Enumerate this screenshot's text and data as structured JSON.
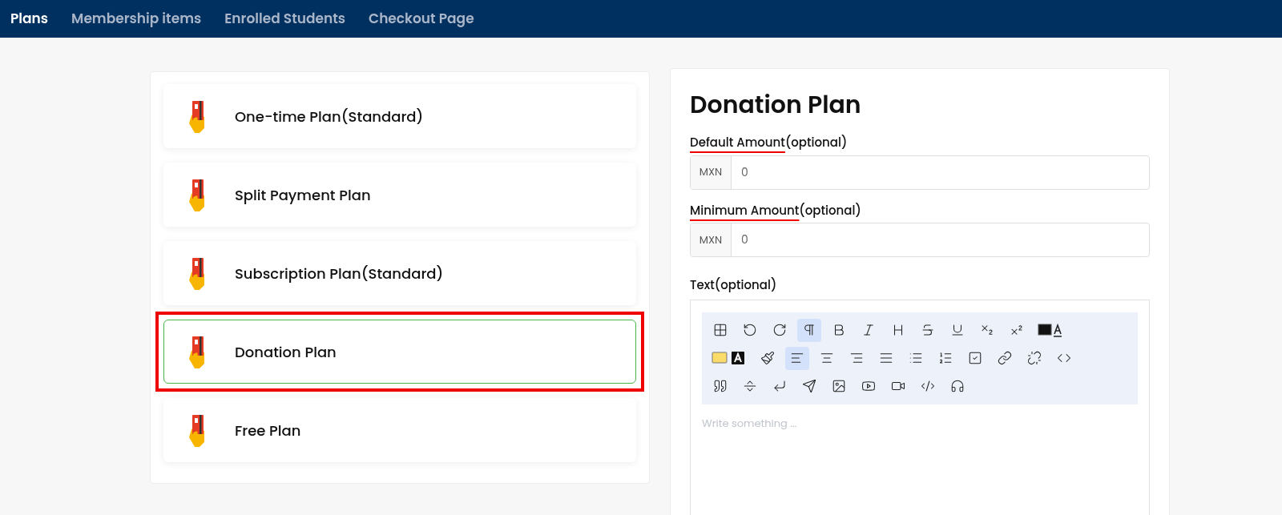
{
  "nav": {
    "tabs": [
      {
        "label": "Plans",
        "selected": true
      },
      {
        "label": "Membership items",
        "selected": false
      },
      {
        "label": "Enrolled Students",
        "selected": false
      },
      {
        "label": "Checkout Page",
        "selected": false
      }
    ]
  },
  "plans": [
    {
      "name": "One-time Plan(Standard)",
      "selected": false,
      "highlighted": false
    },
    {
      "name": "Split Payment Plan",
      "selected": false,
      "highlighted": false
    },
    {
      "name": "Subscription Plan(Standard)",
      "selected": false,
      "highlighted": false
    },
    {
      "name": "Donation Plan",
      "selected": true,
      "highlighted": true
    },
    {
      "name": "Free Plan",
      "selected": false,
      "highlighted": false
    }
  ],
  "form": {
    "title": "Donation Plan",
    "fields": [
      {
        "label": "Default Amount",
        "suffix": "(optional)",
        "underlined": true,
        "currency": "MXN",
        "value": "0"
      },
      {
        "label": "Minimum Amount",
        "suffix": "(optional)",
        "underlined": true,
        "currency": "MXN",
        "value": "0"
      }
    ],
    "editor": {
      "label": "Text(optional)",
      "placeholder": "Write something ...",
      "toolbar": [
        [
          {
            "kind": "table",
            "active": false
          },
          {
            "kind": "undo",
            "active": false
          },
          {
            "kind": "redo",
            "active": false
          },
          {
            "kind": "paragraph",
            "active": true
          },
          {
            "kind": "bold",
            "active": false
          },
          {
            "kind": "italic",
            "active": false
          },
          {
            "kind": "heading",
            "active": false
          },
          {
            "kind": "strike",
            "active": false
          },
          {
            "kind": "underline",
            "active": false
          },
          {
            "kind": "subscript",
            "active": false
          },
          {
            "kind": "superscript",
            "active": false
          },
          {
            "kind": "forecolor",
            "active": false
          }
        ],
        [
          {
            "kind": "highlight",
            "active": false
          },
          {
            "kind": "clear",
            "active": false
          },
          {
            "kind": "align-left",
            "active": true
          },
          {
            "kind": "align-center",
            "active": false
          },
          {
            "kind": "align-right",
            "active": false
          },
          {
            "kind": "align-justify",
            "active": false
          },
          {
            "kind": "bullet-list",
            "active": false
          },
          {
            "kind": "ordered-list",
            "active": false
          },
          {
            "kind": "task-list",
            "active": false
          },
          {
            "kind": "link",
            "active": false
          },
          {
            "kind": "unlink",
            "active": false
          },
          {
            "kind": "code",
            "active": false
          }
        ],
        [
          {
            "kind": "quote",
            "active": false
          },
          {
            "kind": "page-break",
            "active": false
          },
          {
            "kind": "line-break",
            "active": false
          },
          {
            "kind": "send",
            "active": false
          },
          {
            "kind": "image",
            "active": false
          },
          {
            "kind": "youtube",
            "active": false
          },
          {
            "kind": "video",
            "active": false
          },
          {
            "kind": "code-block",
            "active": false
          },
          {
            "kind": "audio",
            "active": false
          }
        ]
      ]
    }
  }
}
